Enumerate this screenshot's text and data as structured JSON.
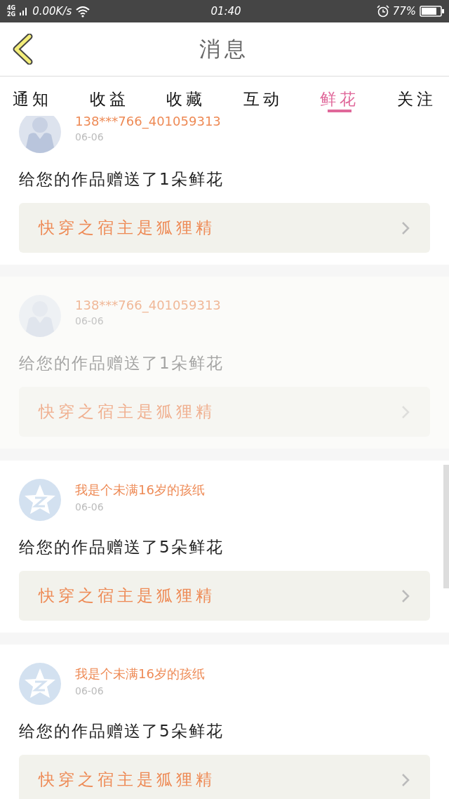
{
  "status_bar": {
    "network_top": "4G",
    "network_bottom": "2G",
    "speed": "0.00K/s",
    "time": "01:40",
    "battery": "77%"
  },
  "header": {
    "title": "消息"
  },
  "tabs": [
    {
      "label": "通知",
      "selected": false
    },
    {
      "label": "收益",
      "selected": false
    },
    {
      "label": "收藏",
      "selected": false
    },
    {
      "label": "互动",
      "selected": false
    },
    {
      "label": "鲜花",
      "selected": true
    },
    {
      "label": "关注",
      "selected": false
    }
  ],
  "messages": [
    {
      "kind": "silhouette",
      "name": "138***766_401059313",
      "date": "06-06",
      "text": "给您的作品赠送了1朵鲜花",
      "book": "快穿之宿主是狐狸精",
      "faded": false
    },
    {
      "kind": "silhouette",
      "name": "138***766_401059313",
      "date": "06-06",
      "text": "给您的作品赠送了1朵鲜花",
      "book": "快穿之宿主是狐狸精",
      "faded": true
    },
    {
      "kind": "star",
      "name": "我是个未满16岁的孩纸",
      "date": "06-06",
      "text": "给您的作品赠送了5朵鲜花",
      "book": "快穿之宿主是狐狸精",
      "faded": false
    },
    {
      "kind": "star",
      "name": "我是个未满16岁的孩纸",
      "date": "06-06",
      "text": "给您的作品赠送了5朵鲜花",
      "book": "快穿之宿主是狐狸精",
      "faded": false
    }
  ]
}
